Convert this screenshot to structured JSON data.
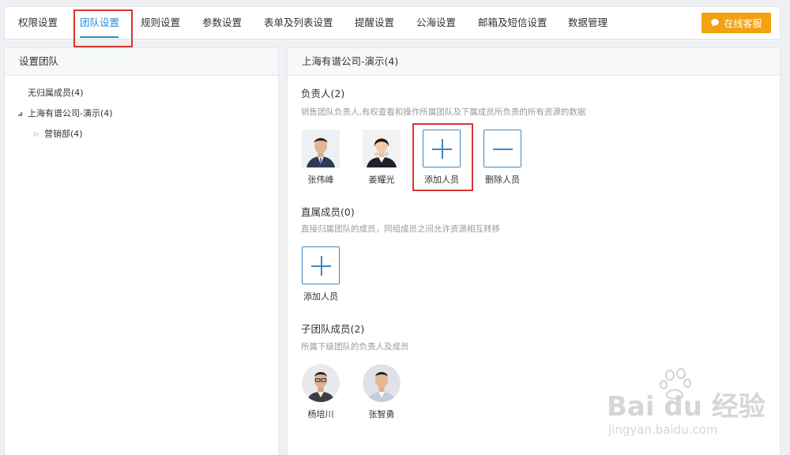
{
  "nav": {
    "tabs": [
      {
        "label": "权限设置"
      },
      {
        "label": "团队设置"
      },
      {
        "label": "规则设置"
      },
      {
        "label": "参数设置"
      },
      {
        "label": "表单及列表设置"
      },
      {
        "label": "提醒设置"
      },
      {
        "label": "公海设置"
      },
      {
        "label": "邮箱及短信设置"
      },
      {
        "label": "数据管理"
      }
    ],
    "active_tab": "团队设置",
    "support_button": "在线客服"
  },
  "left_panel": {
    "title": "设置团队",
    "tree": [
      {
        "label": "无归属成员(4)"
      },
      {
        "label": "上海有谱公司-演示(4)"
      },
      {
        "label": "营销部(4)"
      }
    ]
  },
  "right_panel": {
    "title": "上海有谱公司-演示(4)",
    "leaders": {
      "title": "负责人(2)",
      "description": "销售团队负责人,有权查看和操作所属团队及下属成员所负责的所有资源的数据",
      "members": [
        {
          "name": "张伟峰"
        },
        {
          "name": "姜耀光"
        }
      ],
      "add_label": "添加人员",
      "remove_label": "删除人员"
    },
    "direct": {
      "title": "直属成员(0)",
      "description": "直接归属团队的成员，同组成员之间允许资源相互转移",
      "add_label": "添加人员"
    },
    "sub_team": {
      "title": "子团队成员(2)",
      "description": "所属下级团队的负责人及成员",
      "members": [
        {
          "name": "杨培川"
        },
        {
          "name": "张智勇"
        }
      ]
    }
  },
  "watermark": {
    "brand": "Bai du 经验",
    "url": "jingyan.baidu.com"
  },
  "colors": {
    "accent": "#2b8bd6",
    "highlight": "#d9352f",
    "support": "#f3a111",
    "button_border": "#3f86c1"
  },
  "icons": {
    "support": "chat-bubble-icon",
    "add": "plus-icon",
    "remove": "minus-icon",
    "tree_expanded": "triangle-down-icon",
    "tree_collapsed": "triangle-right-icon"
  }
}
